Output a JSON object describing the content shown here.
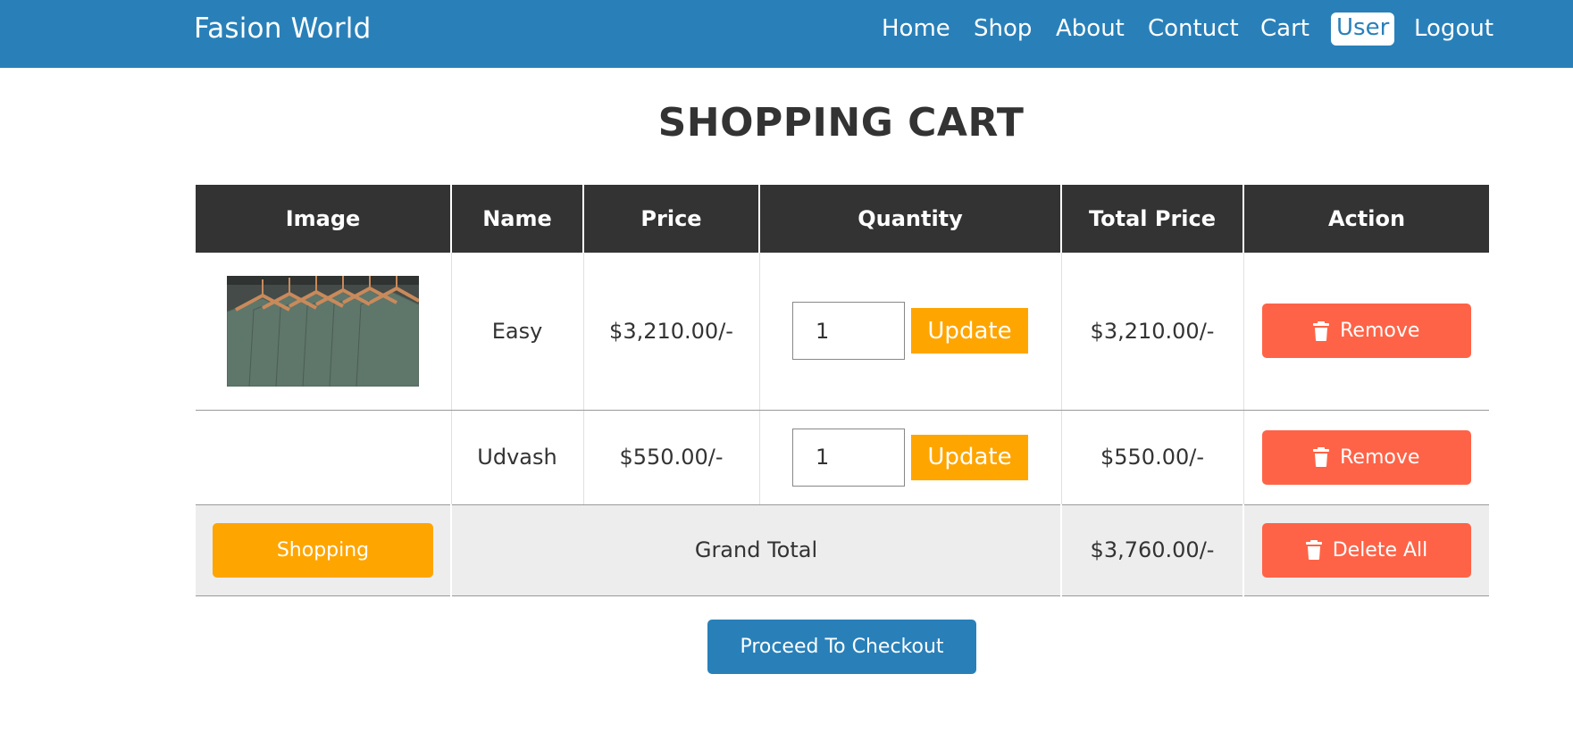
{
  "navbar": {
    "brand": "Fasion World",
    "links": [
      "Home",
      "Shop",
      "About",
      "Contuct",
      "Cart",
      "User",
      "Logout"
    ],
    "active_link": "User"
  },
  "page_title": "SHOPPING CART",
  "table": {
    "headers": [
      "Image",
      "Name",
      "Price",
      "Quantity",
      "Total Price",
      "Action"
    ],
    "rows": [
      {
        "image": "hanging-shirts-image",
        "name": "Easy",
        "price": "$3,210.00/-",
        "quantity": "1",
        "update_label": "Update",
        "total_price": "$3,210.00/-",
        "remove_label": "Remove"
      },
      {
        "image": "",
        "name": "Udvash",
        "price": "$550.00/-",
        "quantity": "1",
        "update_label": "Update",
        "total_price": "$550.00/-",
        "remove_label": "Remove"
      }
    ],
    "footer": {
      "shopping_label": "Shopping",
      "grand_total_label": "Grand Total",
      "grand_total_value": "$3,760.00/-",
      "delete_all_label": "Delete All"
    }
  },
  "checkout_label": "Proceed To Checkout",
  "colors": {
    "navbar": "#2980b9",
    "header_bg": "#333333",
    "update": "#ffa500",
    "remove": "#ff6347",
    "footer_bg": "#ededed"
  },
  "icons": [
    "trash-icon"
  ]
}
